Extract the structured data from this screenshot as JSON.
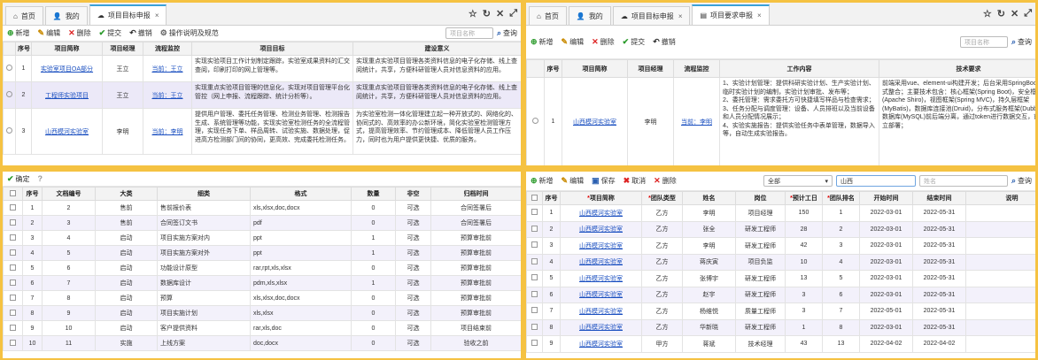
{
  "p1": {
    "tabs": [
      {
        "icon": "⌂",
        "label": "首页"
      },
      {
        "icon": "👤",
        "label": "我的"
      },
      {
        "icon": "☁",
        "label": "项目目标申报",
        "close": "×"
      }
    ],
    "window_controls": [
      "☆",
      "↻",
      "✕",
      "⤢"
    ],
    "toolbar": [
      {
        "icon": "⊕",
        "label": "新增",
        "color": "#2a9a2a"
      },
      {
        "icon": "✎",
        "label": "编辑",
        "color": "#c98a00"
      },
      {
        "icon": "✕",
        "label": "删除",
        "color": "#d22"
      },
      {
        "icon": "✔",
        "label": "提交",
        "color": "#2a9a2a"
      },
      {
        "icon": "↶",
        "label": "撤销",
        "color": "#333"
      },
      {
        "icon": "⚙",
        "label": "操作说明及规范",
        "color": "#666"
      }
    ],
    "search_placeholder": "项目名称",
    "search_label": "查询",
    "headers": [
      "序号",
      "项目简称",
      "项目经理",
      "流程监控",
      "项目目标",
      "建设意义"
    ],
    "rows": [
      {
        "no": "1",
        "name": "实验室项目OA部分",
        "pm": "王立",
        "flow": "当前：王立",
        "goal": "实现实验项目工作计划制定跟踪，实验室成果资料的汇交查阅，印刷打印的网上管理等。",
        "meaning": "实现重点实验项目管理各类资料信息的电子化存储、线上查阅统计，共享，方便科研管理人员对信息资料的应用。"
      },
      {
        "no": "2",
        "name": "工程师实验项目",
        "pm": "王立",
        "flow": "当前：王立",
        "goal": "实现重点实验项目管理的信息化，实现对项目管理平台化管控（网上申报、流程跟踪、统计分析等）。",
        "meaning": "实现重点实验项目管理各类资料信息的电子化存储、线上查阅统计，共享，方便科研管理人员对信息资料的应用。"
      },
      {
        "no": "3",
        "name": "山西模河实验室",
        "pm": "李明",
        "flow": "当前：李明",
        "goal": "提供用户管理、委托任务管理、检测业务管理、检测报告生成、系统管理等功能，实现实验室检测任务的全流程管理，实现任务下单、样品周转、试验实施、数据处理，促进高方检测部门间的协同，更高效、完成委托检测任务。",
        "meaning": "为实验室检测一体化管理建立起一种开放式的、网络化的、协同式的、高效率的办公新环境，简化实验室检测管理方式，提高管理效率、节约管理成本、降低管理人员工作压力，同时也为用户提供更快捷、优质的服务。"
      }
    ]
  },
  "p2": {
    "tabs": [
      {
        "icon": "⌂",
        "label": "首页"
      },
      {
        "icon": "👤",
        "label": "我的"
      },
      {
        "icon": "☁",
        "label": "项目目标申报",
        "close": "×"
      },
      {
        "icon": "▤",
        "label": "项目要求申报",
        "close": "×"
      }
    ],
    "window_controls": [
      "☆",
      "↻",
      "✕",
      "⤢"
    ],
    "toolbar": [
      {
        "icon": "⊕",
        "label": "新增",
        "color": "#2a9a2a"
      },
      {
        "icon": "✎",
        "label": "编辑",
        "color": "#c98a00"
      },
      {
        "icon": "✕",
        "label": "删除",
        "color": "#d22"
      },
      {
        "icon": "✔",
        "label": "提交",
        "color": "#2a9a2a"
      },
      {
        "icon": "↶",
        "label": "撤销",
        "color": "#333"
      }
    ],
    "search_placeholder": "项目名称",
    "search_label": "查询",
    "headers": [
      "序号",
      "项目简称",
      "项目经理",
      "流程监控",
      "工作内容",
      "技术要求"
    ],
    "row": {
      "no": "1",
      "name": "山西模河实验室",
      "pm": "李明",
      "flow": "当前：李明",
      "work": "1、实验计划管理：提供科研实验计划、生产实验计划、临时实验计划的编制，实验计划审批、发布等；\n2、委托管理：需求委托方可快捷填写样品与检查需求；\n3、任务分配与调度管理：设备、人员排班以及当前设备和人员分配情况展示；\n4、实验实施报告：提供实验任务中表单管理，数据导入等，自动生成实验报告。",
      "tech": "前端采用vue、element-ui构建开发；后台采用SpringBoot分布式整合；主要技术包含：核心框架(Spring Boot)，安全框架(Apache Shiro)，视图框架(Spring MVC)，持久层框架(MyBatis)，数据库连接池(Druid)，分布式服务框架(Dubbo)，数据库(MySQL)前后端分离，通过token进行数据交互，前端独立部署；"
    }
  },
  "p3": {
    "toolbar": [
      {
        "icon": "✔",
        "label": "确定",
        "color": "#2a9a2a"
      },
      {
        "icon": "?",
        "label": "",
        "color": "#999"
      }
    ],
    "headers": [
      "序号",
      "文档编号",
      "大类",
      "细类",
      "格式",
      "数量",
      "非空",
      "归档时间"
    ],
    "rows": [
      [
        "1",
        "2",
        "售前",
        "售前报价表",
        "xls,xlsx,doc,docx",
        "0",
        "可选",
        "合同签署后"
      ],
      [
        "2",
        "3",
        "售前",
        "合同签订文书",
        "pdf",
        "0",
        "可选",
        "合同签署后"
      ],
      [
        "3",
        "4",
        "启动",
        "项目实施方案对内",
        "ppt",
        "1",
        "可选",
        "预算审批前"
      ],
      [
        "4",
        "5",
        "启动",
        "项目实施方案对外",
        "ppt",
        "1",
        "可选",
        "预算审批前"
      ],
      [
        "5",
        "6",
        "启动",
        "功能设计原型",
        "rar,rpt,xls,xlsx",
        "0",
        "可选",
        "预算审批前"
      ],
      [
        "6",
        "7",
        "启动",
        "数据库设计",
        "pdm,xls,xlsx",
        "1",
        "可选",
        "预算审批前"
      ],
      [
        "7",
        "8",
        "启动",
        "预算",
        "xls,xlsx,doc,docx",
        "0",
        "可选",
        "预算审批前"
      ],
      [
        "8",
        "9",
        "启动",
        "项目实施计划",
        "xls,xlsx",
        "0",
        "可选",
        "预算审批前"
      ],
      [
        "9",
        "10",
        "启动",
        "客户提供资料",
        "rar,xls,doc",
        "0",
        "可选",
        "项目结束前"
      ],
      [
        "10",
        "11",
        "实施",
        "上线方案",
        "doc,docx",
        "0",
        "可选",
        "验收之前"
      ]
    ]
  },
  "p4": {
    "toolbar": [
      {
        "icon": "⊕",
        "label": "新增",
        "color": "#2a9a2a"
      },
      {
        "icon": "✎",
        "label": "编辑",
        "color": "#c98a00"
      },
      {
        "icon": "▣",
        "label": "保存",
        "color": "#2a5fb0"
      },
      {
        "icon": "✖",
        "label": "取消",
        "color": "#d22"
      },
      {
        "icon": "✕",
        "label": "删除",
        "color": "#d22"
      }
    ],
    "filter_select": "全部",
    "filter_value": "山西",
    "name_placeholder": "姓名",
    "search_label": "查询",
    "headers": [
      "序号",
      "项目简称",
      "团队类型",
      "姓名",
      "岗位",
      "预计工日",
      "团队排名",
      "开始时间",
      "结束时间",
      "说明"
    ],
    "required": [
      false,
      true,
      true,
      false,
      false,
      true,
      true,
      false,
      false,
      false
    ],
    "rows": [
      [
        "1",
        "山西模河实验室",
        "乙方",
        "李明",
        "项目经理",
        "150",
        "1",
        "2022-03-01",
        "2022-05-31"
      ],
      [
        "2",
        "山西模河实验室",
        "乙方",
        "张全",
        "研发工程师",
        "28",
        "2",
        "2022-03-01",
        "2022-05-31"
      ],
      [
        "3",
        "山西模河实验室",
        "乙方",
        "李明",
        "研发工程师",
        "42",
        "3",
        "2022-03-01",
        "2022-05-31"
      ],
      [
        "4",
        "山西模河实验室",
        "乙方",
        "蒋庆寅",
        "项目负监",
        "10",
        "4",
        "2022-03-01",
        "2022-05-31"
      ],
      [
        "5",
        "山西模河实验室",
        "乙方",
        "张博宇",
        "研发工程师",
        "13",
        "5",
        "2022-03-01",
        "2022-05-31"
      ],
      [
        "6",
        "山西模河实验室",
        "乙方",
        "赵宇",
        "研发工程师",
        "3",
        "6",
        "2022-03-01",
        "2022-05-31"
      ],
      [
        "7",
        "山西模河实验室",
        "乙方",
        "杨维悦",
        "质量工程师",
        "3",
        "7",
        "2022-05-01",
        "2022-05-31"
      ],
      [
        "8",
        "山西模河实验室",
        "乙方",
        "华新晓",
        "研发工程师",
        "1",
        "8",
        "2022-03-01",
        "2022-05-31"
      ],
      [
        "9",
        "山西模河实验室",
        "甲方",
        "蒋斌",
        "技术经理",
        "43",
        "13",
        "2022-04-02",
        "2022-04-02"
      ]
    ]
  }
}
